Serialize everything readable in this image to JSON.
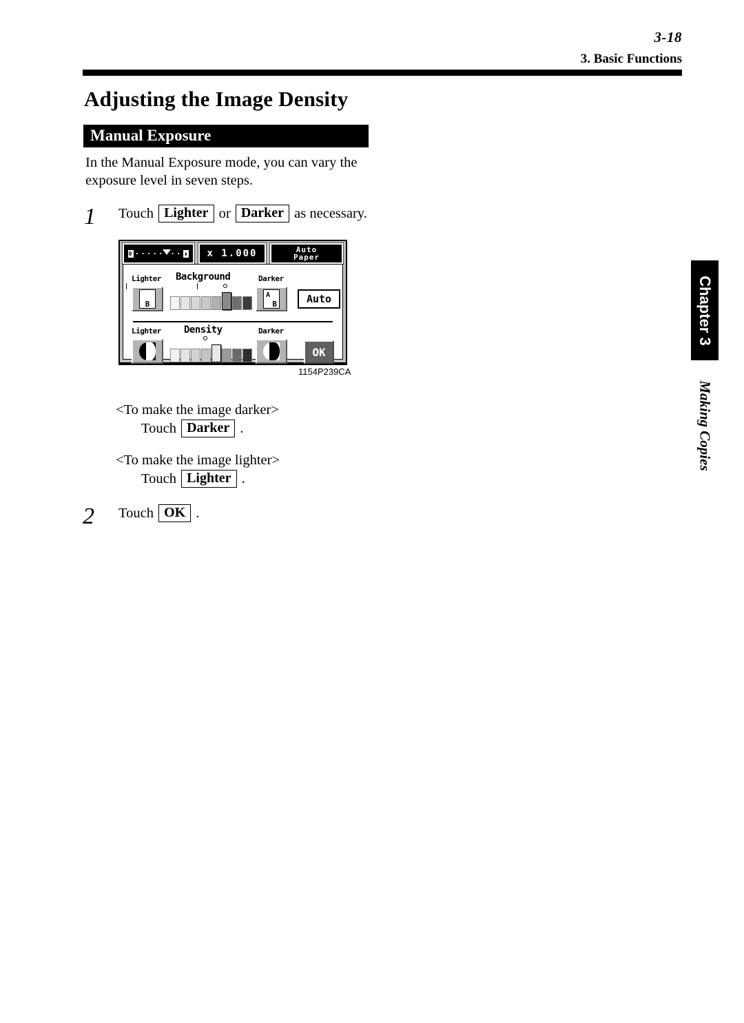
{
  "header": {
    "page_number": "3-18",
    "chapter_title": "3. Basic Functions"
  },
  "page_title": "Adjusting the Image Density",
  "section": {
    "title": "Manual Exposure",
    "intro": "In the Manual Exposure mode, you can vary the exposure level in seven steps."
  },
  "steps": [
    {
      "number": "1",
      "text_before": "Touch",
      "key1": "Lighter",
      "text_middle": "or",
      "key2": "Darker",
      "text_after": "as necessary."
    },
    {
      "number": "2",
      "text_before": "Touch",
      "key1": "OK",
      "text_after": "."
    }
  ],
  "notes": [
    {
      "heading": "<To make the image darker>",
      "prefix": "Touch",
      "key": "Darker",
      "suffix": "."
    },
    {
      "heading": "<To make the image lighter>",
      "prefix": "Touch",
      "key": "Lighter",
      "suffix": "."
    }
  ],
  "figure": {
    "caption": "1154P239CA",
    "lcd": {
      "topbar": {
        "paper_indicator": {
          "left_icon": "0",
          "dots": "········",
          "right_icon": "◗",
          "marker": "triangle-down"
        },
        "zoom_display": "x 1.000",
        "paper_mode_line1": "Auto",
        "paper_mode_line2": "Paper"
      },
      "background_row": {
        "lighter_label": "Lighter",
        "title": "Background",
        "darker_label": "Darker",
        "lighter_icon": "B",
        "darker_icon_top": "A",
        "darker_icon_bottom": "B",
        "auto_button": "Auto",
        "steps": 7,
        "selected_index": 6
      },
      "density_row": {
        "lighter_label": "Lighter",
        "title": "Density",
        "darker_label": "Darker",
        "lighter_icon": "half-circle-left-dark",
        "darker_icon": "half-circle-right-dark",
        "ok_button": "OK",
        "steps": 7,
        "selected_index": 4
      }
    }
  },
  "side_tab": {
    "chapter": "Chapter 3",
    "section_name": "Making Copies"
  }
}
